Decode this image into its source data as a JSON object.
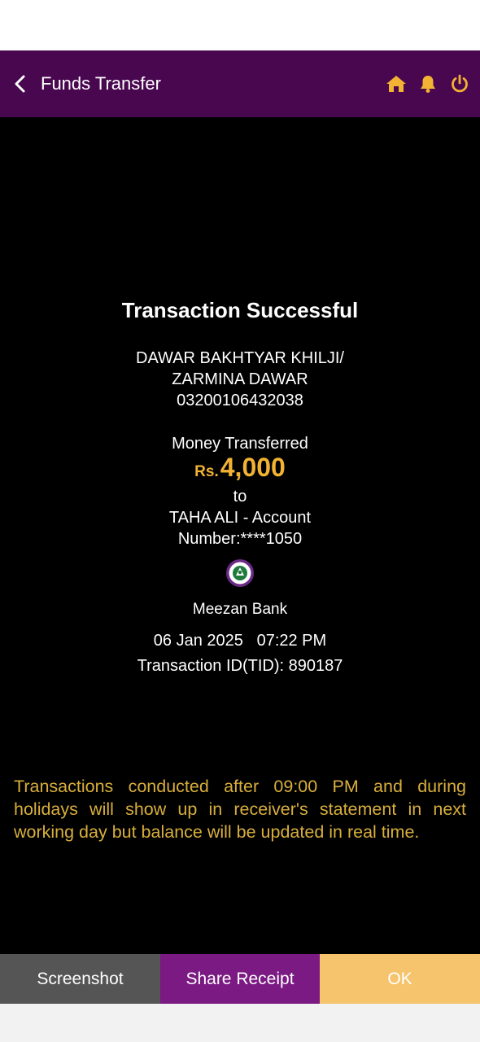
{
  "header": {
    "title": "Funds Transfer",
    "icons": [
      "back-chevron",
      "home-icon",
      "bell-icon",
      "power-icon"
    ],
    "background": "#48074f",
    "icon_color": "#f2b233"
  },
  "receipt": {
    "status_title": "Transaction Successful",
    "sender_name_line1": "DAWAR BAKHTYAR KHILJI/",
    "sender_name_line2": "ZARMINA DAWAR",
    "sender_account": "03200106432038",
    "money_label": "Money Transferred",
    "currency": "Rs.",
    "amount": "4,000",
    "to_label": "to",
    "recipient_line1": "TAHA ALI  - Account",
    "recipient_line2": "Number:****1050",
    "bank_name": "Meezan Bank",
    "bank_logo_text": "MEEZAN BANK",
    "date": "06 Jan 2025",
    "time": "07:22 PM",
    "transaction_id": "Transaction ID(TID): 890187"
  },
  "notice": "Transactions conducted after 09:00 PM and during holidays will show up in receiver's statement in next working day but balance will be updated in real time.",
  "footer": {
    "screenshot_label": "Screenshot",
    "share_label": "Share Receipt",
    "ok_label": "OK",
    "colors": {
      "screenshot": "#555555",
      "share": "#7b1a83",
      "ok": "#f5c46c"
    }
  }
}
